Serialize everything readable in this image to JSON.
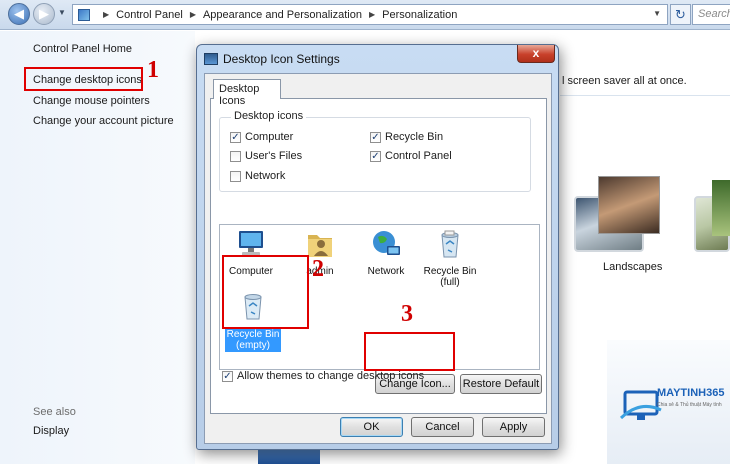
{
  "explorer": {
    "breadcrumbs": [
      "Control Panel",
      "Appearance and Personalization",
      "Personalization"
    ],
    "search_placeholder": "Search"
  },
  "left_pane": {
    "links": [
      "Control Panel Home",
      "Change desktop icons",
      "Change mouse pointers",
      "Change your account picture"
    ],
    "see_also": "See also",
    "display": "Display"
  },
  "background": {
    "description_fragment": "l screen saver all at once.",
    "theme_label": "Landscapes"
  },
  "dialog": {
    "title": "Desktop Icon Settings",
    "close_label": "x",
    "tab": "Desktop Icons",
    "group_title": "Desktop icons",
    "checkboxes": [
      {
        "label": "Computer",
        "checked": true
      },
      {
        "label": "Recycle Bin",
        "checked": true
      },
      {
        "label": "User's Files",
        "checked": false
      },
      {
        "label": "Control Panel",
        "checked": true
      },
      {
        "label": "Network",
        "checked": false
      }
    ],
    "icons": [
      {
        "name": "Computer"
      },
      {
        "name": "admin"
      },
      {
        "name": "Network"
      },
      {
        "name": "Recycle Bin\n(full)"
      },
      {
        "name": "Recycle Bin\n(empty)",
        "selected": true
      }
    ],
    "change_icon_label": "Change Icon...",
    "restore_default_label": "Restore Default",
    "allow_themes": {
      "label": "Allow themes to change desktop icons",
      "checked": true
    },
    "ok_label": "OK",
    "cancel_label": "Cancel",
    "apply_label": "Apply"
  },
  "annotations": {
    "step1": "1",
    "step2": "2",
    "step3": "3",
    "color": "#e00000"
  },
  "watermark": {
    "brand": "MAYTINH365",
    "tagline": "Chia sẻ & Thủ thuật Máy tính"
  }
}
